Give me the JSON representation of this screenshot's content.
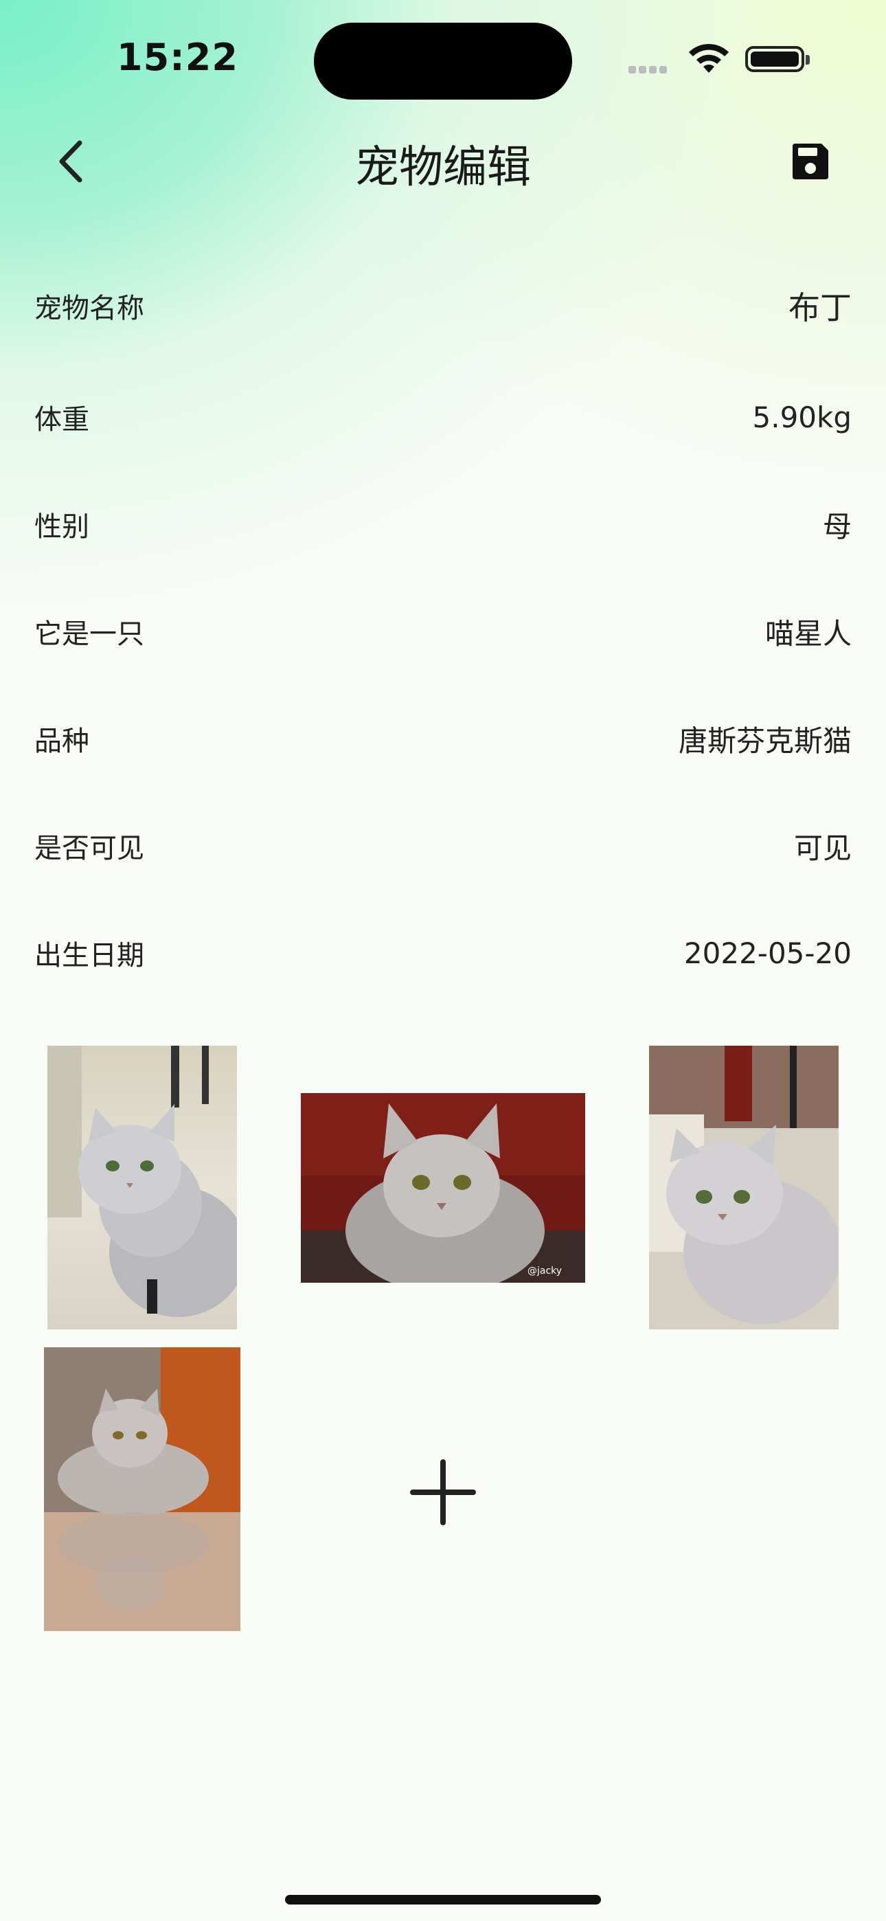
{
  "status_bar": {
    "time": "15:22"
  },
  "header": {
    "title": "宠物编辑",
    "back_icon": "chevron-left-icon",
    "save_icon": "floppy-disk-icon"
  },
  "fields": [
    {
      "label": "宠物名称",
      "value": "布丁"
    },
    {
      "label": "体重",
      "value": "5.90kg"
    },
    {
      "label": "性别",
      "value": "母"
    },
    {
      "label": "它是一只",
      "value": "喵星人"
    },
    {
      "label": "品种",
      "value": "唐斯芬克斯猫"
    },
    {
      "label": "是否可见",
      "value": "可见"
    },
    {
      "label": "出生日期",
      "value": "2022-05-20"
    }
  ],
  "photos": [
    {
      "name": "cat-photo-1",
      "watermark": ""
    },
    {
      "name": "cat-photo-2",
      "watermark": "@jacky"
    },
    {
      "name": "cat-photo-3",
      "watermark": ""
    },
    {
      "name": "cat-photo-4",
      "watermark": ""
    }
  ],
  "add_photo_icon": "plus-icon",
  "colors": {
    "gradient_start": "#78f0c8",
    "gradient_end": "#eefcd2",
    "background": "#f9fbf6",
    "text": "#222222"
  }
}
